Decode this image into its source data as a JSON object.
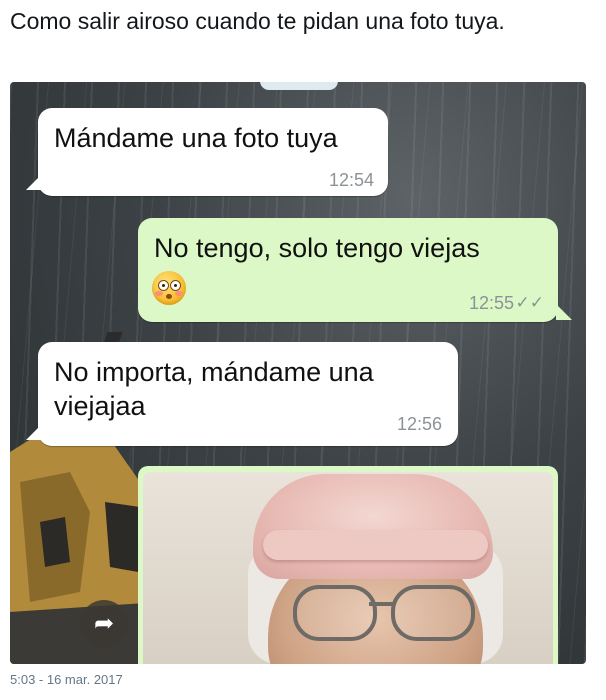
{
  "tweet": {
    "text": "Como salir airoso cuando te pidan una foto tuya.",
    "timestamp": "5:03 - 16 mar. 2017"
  },
  "chat": {
    "messages": [
      {
        "direction": "incoming",
        "text": "Mándame una foto tuya",
        "time": "12:54"
      },
      {
        "direction": "outgoing",
        "text": "No tengo, solo tengo viejas",
        "emoji": "flushed-face-emoji",
        "time": "12:55",
        "status": "read-double-check"
      },
      {
        "direction": "incoming",
        "text_line1": "No importa, mándame una",
        "text_line2": "viejajaa",
        "time": "12:56"
      }
    ],
    "ticks_glyph": "✓✓",
    "share_glyph": "➦"
  },
  "colors": {
    "incoming_bubble": "#ffffff",
    "outgoing_bubble": "#dcf8c6",
    "timestamp_gray": "#8c9396",
    "tweet_text": "#14171a"
  }
}
